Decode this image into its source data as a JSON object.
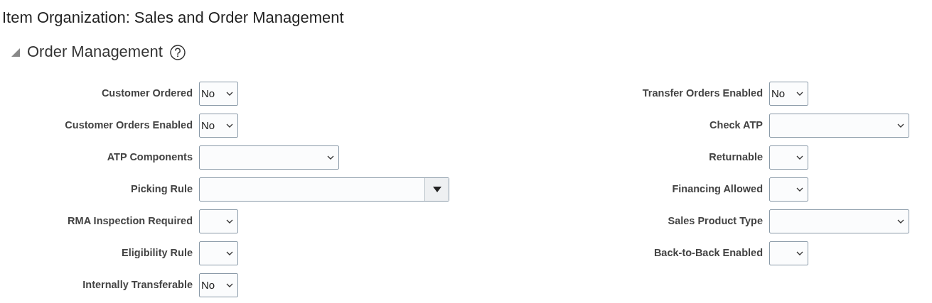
{
  "page_title": "Item Organization: Sales and Order Management",
  "section": {
    "title": "Order Management",
    "expanded": true
  },
  "columns": [
    {
      "fields": [
        {
          "label": "Customer Ordered",
          "kind": "short",
          "value": "No"
        },
        {
          "label": "Customer Orders Enabled",
          "kind": "short",
          "value": "No"
        },
        {
          "label": "ATP Components",
          "kind": "medium"
        },
        {
          "label": "Picking Rule",
          "kind": "combo"
        },
        {
          "label": "RMA Inspection Required",
          "kind": "short"
        },
        {
          "label": "Eligibility Rule",
          "kind": "short"
        },
        {
          "label": "Internally Transferable",
          "kind": "short",
          "value": "No"
        }
      ]
    },
    {
      "fields": [
        {
          "label": "Transfer Orders Enabled",
          "kind": "short",
          "value": "No"
        },
        {
          "label": "Check ATP",
          "kind": "medium"
        },
        {
          "label": "Returnable",
          "kind": "short"
        },
        {
          "label": "Financing Allowed",
          "kind": "short"
        },
        {
          "label": "Sales Product Type",
          "kind": "medium"
        },
        {
          "label": "Back-to-Back Enabled",
          "kind": "short"
        }
      ]
    }
  ]
}
